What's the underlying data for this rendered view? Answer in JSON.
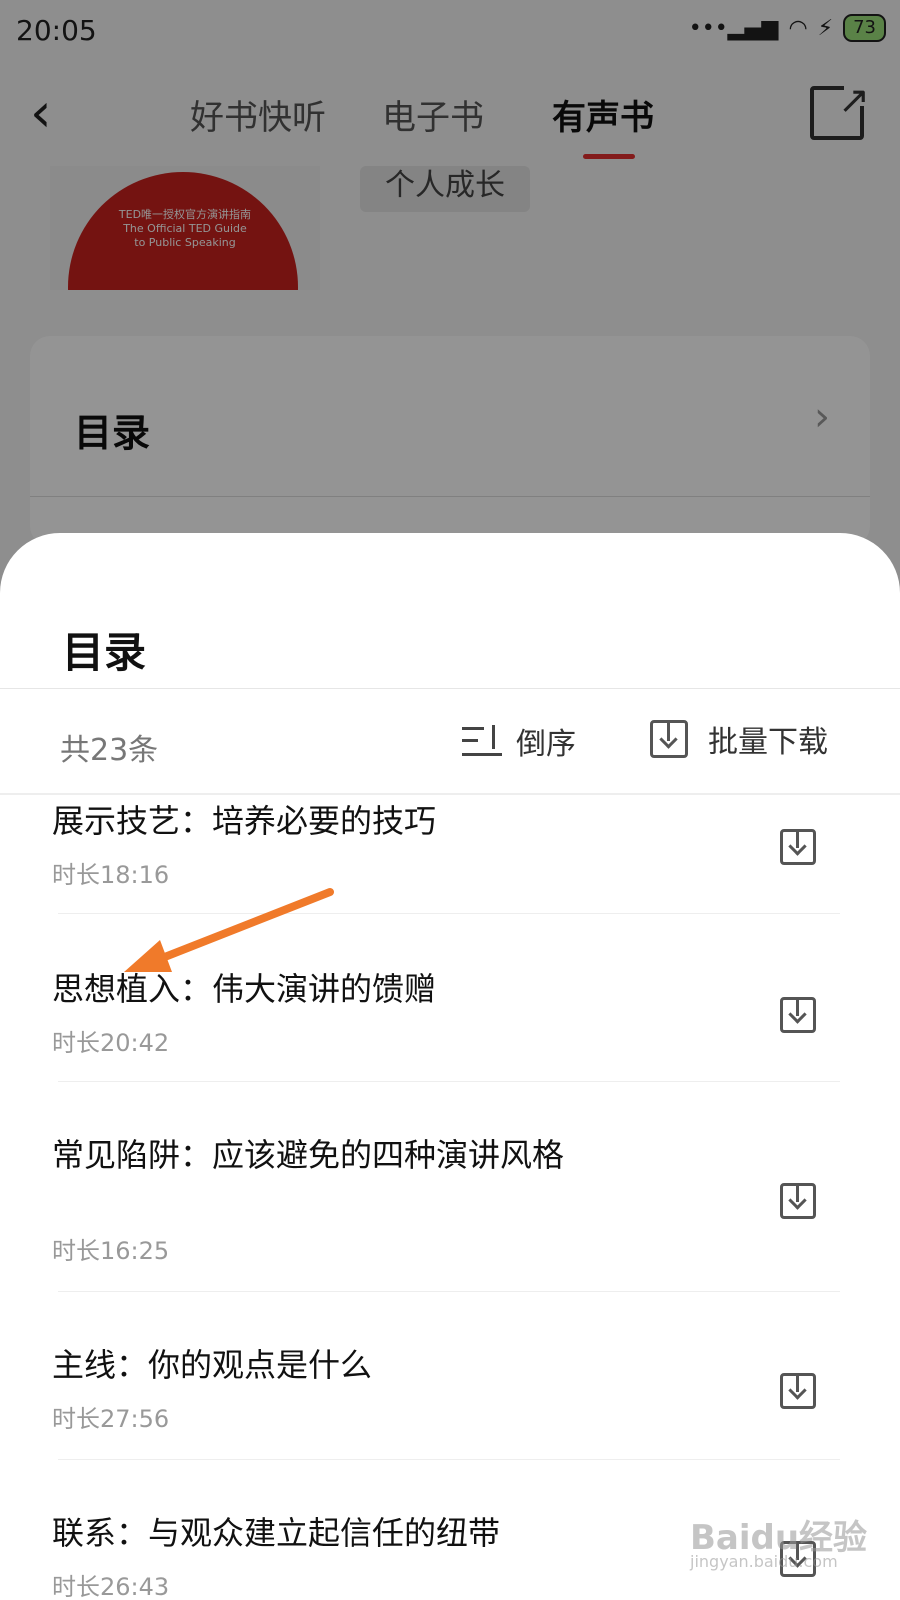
{
  "status_bar": {
    "time": "20:05",
    "battery": "73"
  },
  "nav": {
    "tabs": [
      "好书快听",
      "电子书",
      "有声书"
    ],
    "active_tab": "有声书"
  },
  "book": {
    "cover_lines": [
      "TED唯一授权官方演讲指南",
      "The Official TED Guide",
      "to Public Speaking"
    ],
    "tag": "个人成长"
  },
  "toc_card": {
    "title": "目录"
  },
  "sheet": {
    "title": "目录",
    "count": "共23条",
    "sort_label": "倒序",
    "batch_download_label": "批量下载",
    "items": [
      {
        "title": "展示技艺：培养必要的技巧",
        "duration": "时长18:16"
      },
      {
        "title": "思想植入：伟大演讲的馈赠",
        "duration": "时长20:42"
      },
      {
        "title": "常见陷阱：应该避免的四种演讲风格",
        "duration": "时长16:25"
      },
      {
        "title": "主线：你的观点是什么",
        "duration": "时长27:56"
      },
      {
        "title": "联系：与观众建立起信任的纽带",
        "duration": "时长26:43"
      }
    ]
  },
  "annotation": {
    "arrow_color": "#f07a2a",
    "target_item_index": 1
  },
  "watermark": {
    "text": "Baidu经验",
    "sub": "jingyan.baidu.com"
  }
}
